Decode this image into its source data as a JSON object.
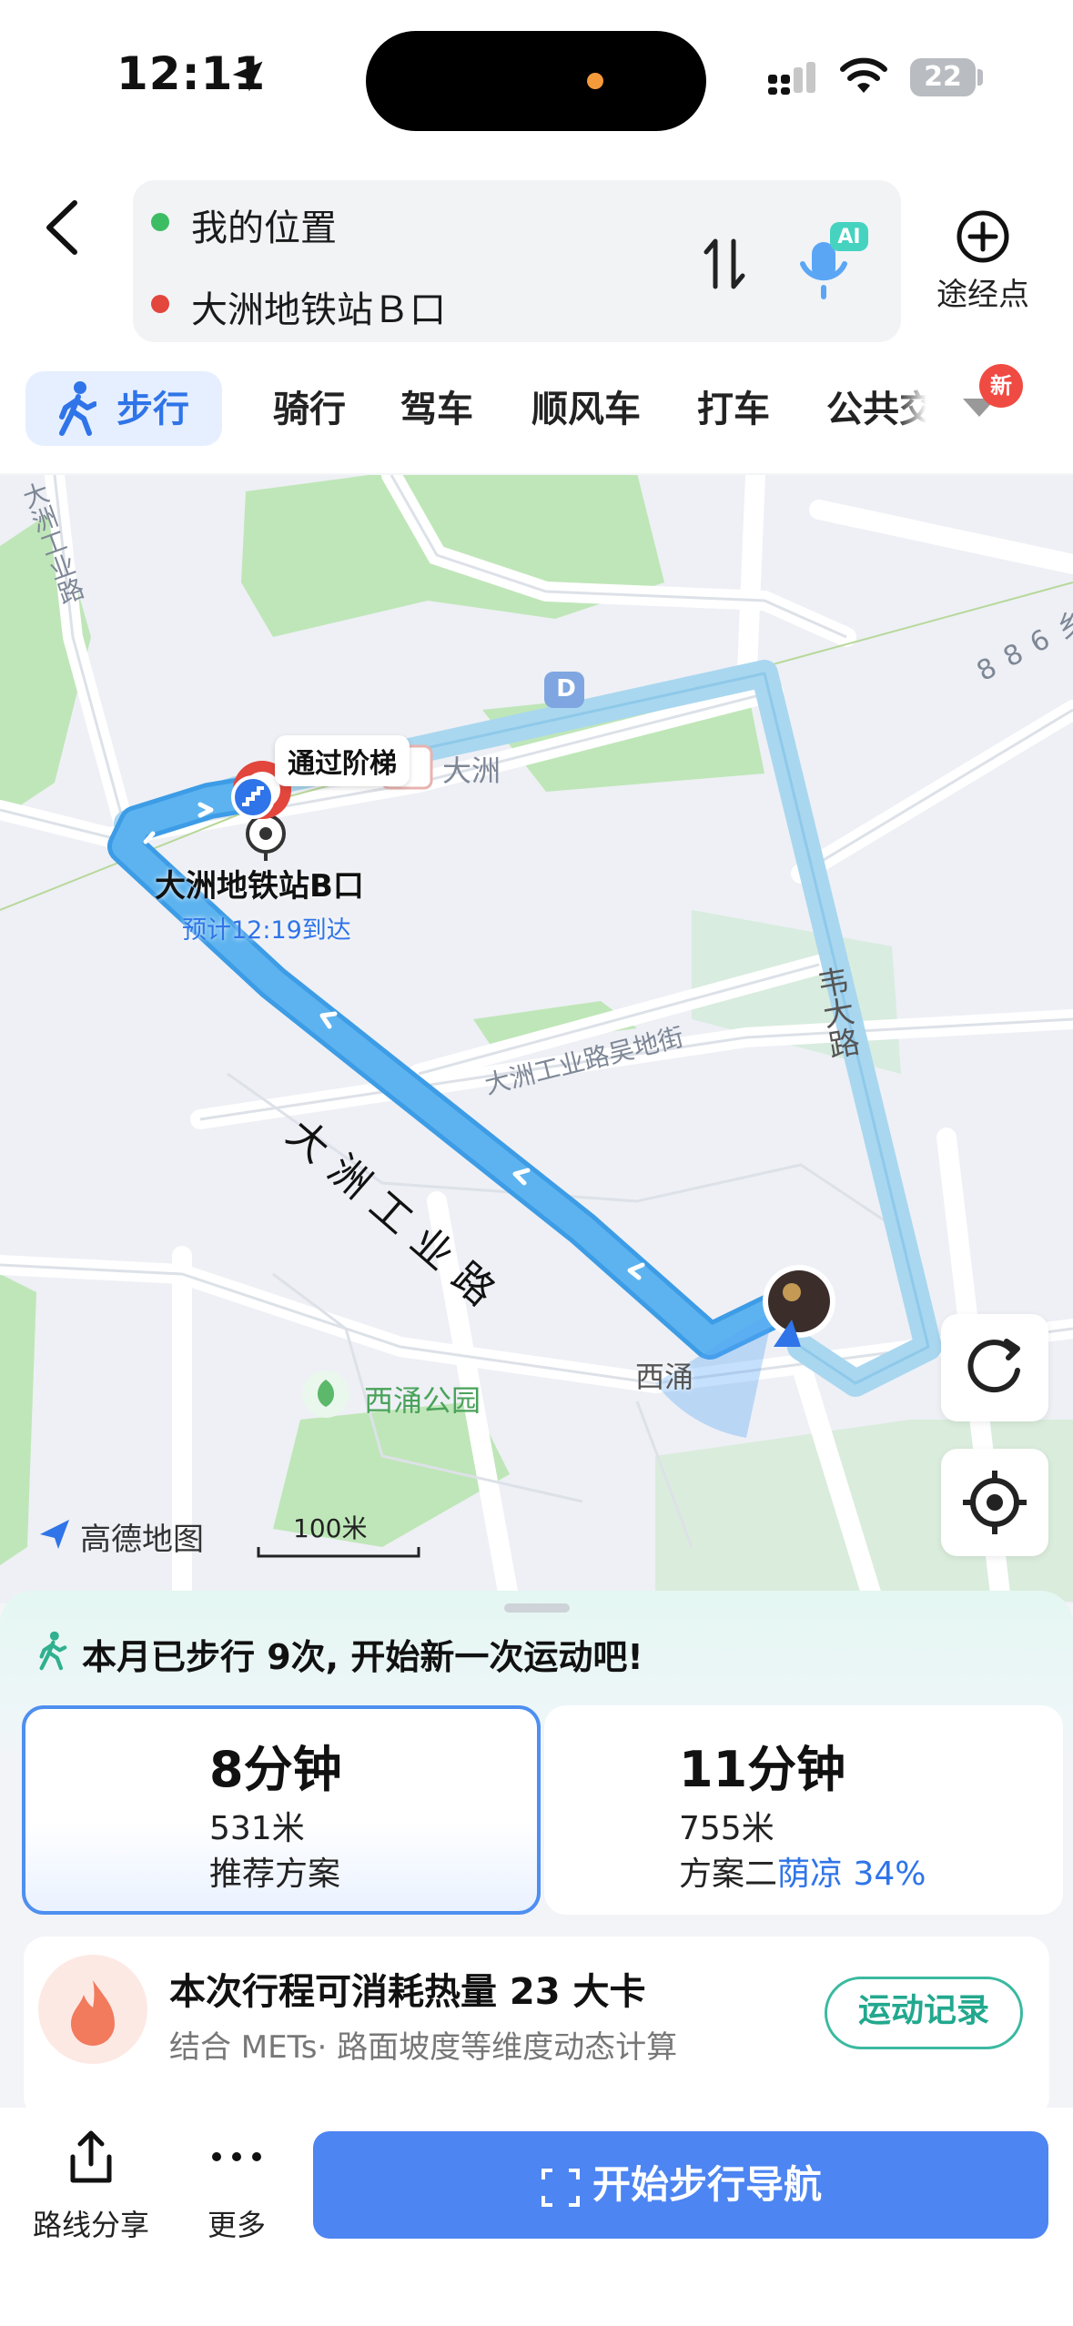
{
  "status_bar": {
    "time": "12:11",
    "battery": "22"
  },
  "header": {
    "origin": "我的位置",
    "destination": "大洲地铁站Ｂ口",
    "mic_badge": "AI",
    "via_label": "途经点"
  },
  "modes": {
    "active": "步行",
    "items": [
      "骑行",
      "驾车",
      "顺风车",
      "打车",
      "公共交"
    ],
    "new_badge": "新"
  },
  "map": {
    "stairs_label": "通过阶梯",
    "destination_name": "大洲地铁站B口",
    "eta": "预计12:19到达",
    "road_main": "大洲工业路",
    "road_wu": "大洲工业路吴地街",
    "road_wei": "韦大路",
    "road_left": "大洲工业路",
    "road_886": "886乡",
    "metro_tag": "D",
    "area_dazhou": "大洲",
    "area_xiyong": "西涌",
    "park": "西涌公园",
    "brand": "高德地图",
    "scale": "100米",
    "route_color": "#5db3ef"
  },
  "panel": {
    "walk_banner": "本月已步行 9次, 开始新一次运动吧!",
    "routes": [
      {
        "time": "8分钟",
        "distance": "531米",
        "note": "推荐方案",
        "selected": true
      },
      {
        "time": "11分钟",
        "distance": "755米",
        "note": "方案二",
        "shade": "荫凉 34%",
        "selected": false
      }
    ],
    "calories_title": "本次行程可消耗热量 23 大卡",
    "calories_sub": "结合 METs· 路面坡度等维度动态计算",
    "record_button": "运动记录"
  },
  "bottom_bar": {
    "share": "路线分享",
    "more": "更多",
    "start_nav": "开始步行导航"
  }
}
